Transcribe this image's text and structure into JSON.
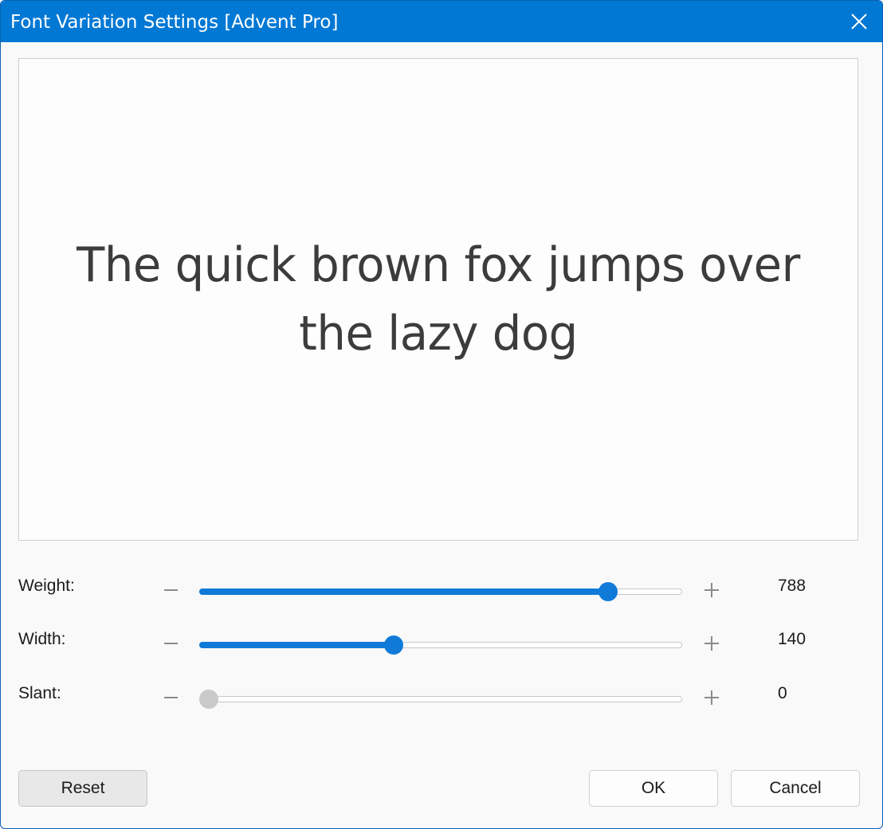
{
  "window": {
    "title": "Font Variation Settings [Advent Pro]"
  },
  "preview": {
    "sample_text": "The quick brown fox jumps over the lazy dog"
  },
  "axes": [
    {
      "label": "Weight:",
      "value": "788",
      "fraction": 0.846,
      "enabled": true
    },
    {
      "label": "Width:",
      "value": "140",
      "fraction": 0.403,
      "enabled": true
    },
    {
      "label": "Slant:",
      "value": "0",
      "fraction": 0.0,
      "enabled": false
    }
  ],
  "buttons": {
    "reset_label": "Reset",
    "ok_label": "OK",
    "cancel_label": "Cancel"
  },
  "icons": {
    "close": "close-icon",
    "minus": "minus-icon",
    "plus": "plus-icon"
  },
  "colors": {
    "titlebar": "#0078d4",
    "accent": "#0f7ad8",
    "disabled_thumb": "#c9c9c9",
    "preview_text": "#3c3c3c"
  }
}
